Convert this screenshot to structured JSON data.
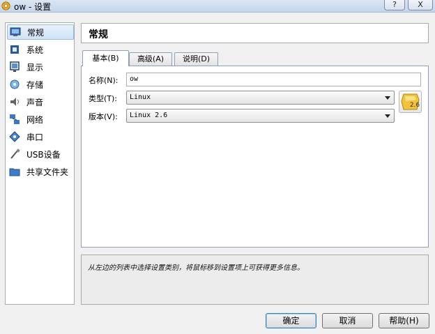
{
  "window": {
    "title": "ow - 设置",
    "help_button": "?",
    "close_button": "X"
  },
  "sidebar": {
    "items": [
      {
        "label": "常规",
        "icon": "monitor-icon",
        "selected": true
      },
      {
        "label": "系统",
        "icon": "chip-icon"
      },
      {
        "label": "显示",
        "icon": "display-icon"
      },
      {
        "label": "存储",
        "icon": "disk-icon"
      },
      {
        "label": "声音",
        "icon": "speaker-icon"
      },
      {
        "label": "网络",
        "icon": "network-icon"
      },
      {
        "label": "串口",
        "icon": "serial-port-icon"
      },
      {
        "label": "USB设备",
        "icon": "usb-icon"
      },
      {
        "label": "共享文件夹",
        "icon": "folder-icon"
      }
    ]
  },
  "page": {
    "title": "常规"
  },
  "tabs": [
    {
      "label": "基本(B)",
      "active": true
    },
    {
      "label": "高级(A)"
    },
    {
      "label": "说明(D)"
    }
  ],
  "form": {
    "name_label": "名称(N):",
    "name_value": "ow",
    "type_label": "类型(T):",
    "type_value": "Linux",
    "version_label": "版本(V):",
    "version_value": "Linux 2.6",
    "os_badge_text": "2.6"
  },
  "description": "从左边的列表中选择设置类别，将鼠标移到设置项上可获得更多信息。",
  "buttons": {
    "ok": "确定",
    "cancel": "取消",
    "help": "帮助(H)"
  }
}
